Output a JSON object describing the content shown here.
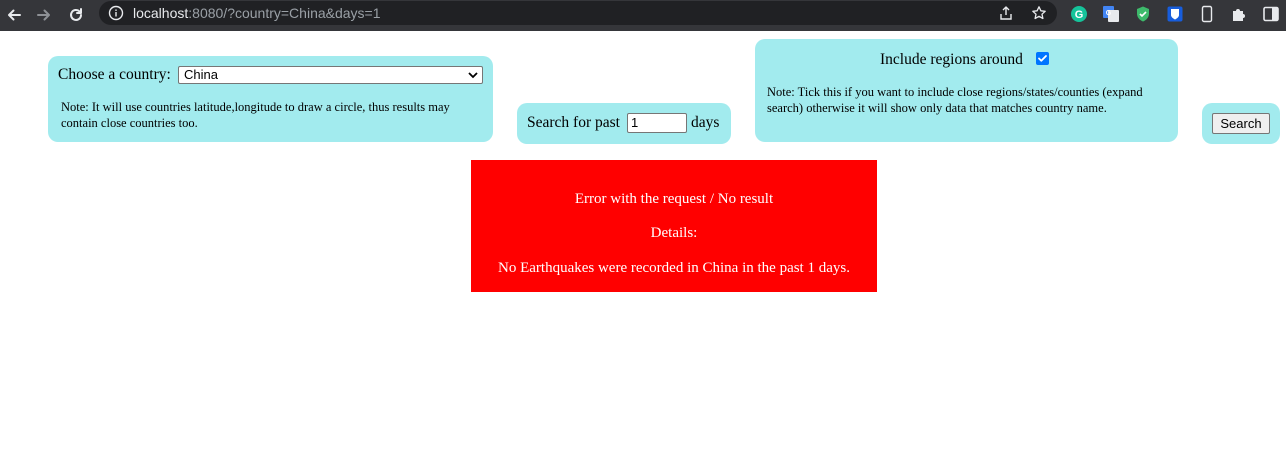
{
  "browser": {
    "url_host": "localhost",
    "url_rest": ":8080/?country=China&days=1",
    "icons": [
      "back-icon",
      "forward-icon",
      "reload-icon",
      "info-icon",
      "share-icon",
      "bookmark-star-icon",
      "grammarly-icon",
      "google-translate-icon",
      "shield-icon",
      "bitwarden-icon",
      "device-icon",
      "extensions-icon",
      "side-panel-icon"
    ]
  },
  "country": {
    "label": "Choose a country:",
    "selected": "China",
    "note": "Note: It will use countries latitude,longitude to draw a circle, thus results may contain close countries too."
  },
  "days": {
    "label_before": "Search for past",
    "value": "1",
    "label_after": "days"
  },
  "regions": {
    "label": "Include regions around",
    "checked": true,
    "note": "Note: Tick this if you want to include close regions/states/counties (expand search) otherwise it will show only data that matches country name."
  },
  "search": {
    "button_label": "Search"
  },
  "error": {
    "title": "Error with the request / No result",
    "details_label": "Details:",
    "message": "No Earthquakes were recorded in China in the past 1 days."
  },
  "colors": {
    "panel": "#a2ebee",
    "error_bg": "#ff0000",
    "error_text": "#ffffff",
    "chrome_bg": "#35363a",
    "checkbox": "#0075ff"
  }
}
